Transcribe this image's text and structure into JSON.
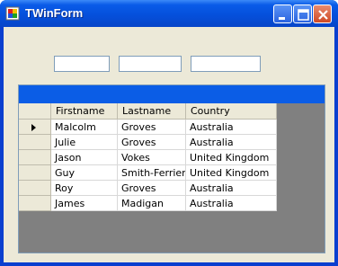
{
  "window": {
    "title": "TWinForm",
    "icons": {
      "app": "app-icon",
      "minimize": "minimize-icon",
      "maximize": "maximize-icon",
      "close": "close-icon"
    }
  },
  "fields": [
    {
      "value": ""
    },
    {
      "value": ""
    },
    {
      "value": ""
    }
  ],
  "grid": {
    "columns": [
      "Firstname",
      "Lastname",
      "Country"
    ],
    "rows": [
      {
        "current": true,
        "cells": [
          "Malcolm",
          "Groves",
          "Australia"
        ]
      },
      {
        "current": false,
        "cells": [
          "Julie",
          "Groves",
          "Australia"
        ]
      },
      {
        "current": false,
        "cells": [
          "Jason",
          "Vokes",
          "United Kingdom"
        ]
      },
      {
        "current": false,
        "cells": [
          "Guy",
          "Smith-Ferrier",
          "United Kingdom"
        ]
      },
      {
        "current": false,
        "cells": [
          "Roy",
          "Groves",
          "Australia"
        ]
      },
      {
        "current": false,
        "cells": [
          "James",
          "Madigan",
          "Australia"
        ]
      }
    ]
  },
  "colors": {
    "titlebar": "#0550dc",
    "caption_band": "#0b5de6",
    "grid_background": "#808080",
    "form_background": "#ece9d8"
  }
}
